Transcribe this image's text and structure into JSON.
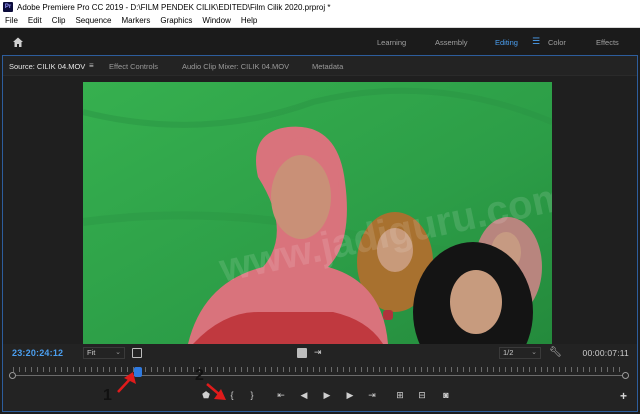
{
  "window": {
    "title": "Adobe Premiere Pro CC 2019 - D:\\FILM PENDEK CILIK\\EDITED\\Film Cilik 2020.prproj *"
  },
  "menu": [
    "File",
    "Edit",
    "Clip",
    "Sequence",
    "Markers",
    "Graphics",
    "Window",
    "Help"
  ],
  "workspaces": [
    "Learning",
    "Assembly",
    "Editing",
    "Color",
    "Effects"
  ],
  "active_workspace": "Editing",
  "panel_tabs": [
    "Source: CILIK 04.MOV",
    "Effect Controls",
    "Audio Clip Mixer: CILIK 04.MOV",
    "Metadata"
  ],
  "viewer": {
    "timecode_current": "23:20:24:12",
    "zoom": "Fit",
    "resolution": "1/2",
    "timecode_duration": "00:00:07:11",
    "watermark": "www.jadiguru.com",
    "playhead_fraction": 0.205
  },
  "controls": [
    "add-marker-icon",
    "mark-in-icon",
    "mark-out-icon",
    "go-to-in-icon",
    "step-back-icon",
    "play-icon",
    "step-forward-icon",
    "go-to-out-icon",
    "insert-icon",
    "overwrite-icon",
    "export-frame-icon",
    "add-button-icon"
  ],
  "annotations": {
    "one": "1",
    "two": "2"
  },
  "colors": {
    "accent": "#4b9ff0",
    "panel_border": "#2d5d9c",
    "green_screen": "#2fa24a",
    "annotation_arrow": "#e01b1b"
  }
}
